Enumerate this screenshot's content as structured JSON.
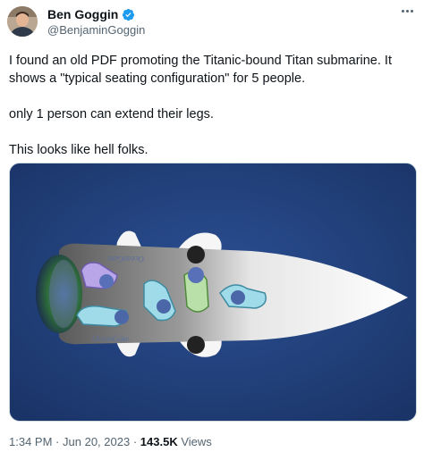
{
  "author": {
    "display_name": "Ben Goggin",
    "handle": "@BenjaminGoggin",
    "verified": true,
    "avatar_icon": "profile-photo"
  },
  "tweet": {
    "paragraphs": [
      "I found an old PDF promoting the Titanic-bound Titan submarine. It shows a \"typical seating configuration\" for 5 people.",
      "only 1 person can extend their legs.",
      "This looks like hell folks."
    ]
  },
  "media": {
    "hull_texts": [
      "OceanGate",
      "OceanGate"
    ],
    "background_color": "#22427c"
  },
  "meta": {
    "time": "1:34 PM",
    "separator1": "·",
    "date": "Jun 20, 2023",
    "separator2": "·",
    "views_count": "143.5K",
    "views_label": "Views"
  },
  "colors": {
    "text_primary": "#0f1419",
    "text_secondary": "#536471",
    "verified_blue": "#1d9bf0"
  }
}
